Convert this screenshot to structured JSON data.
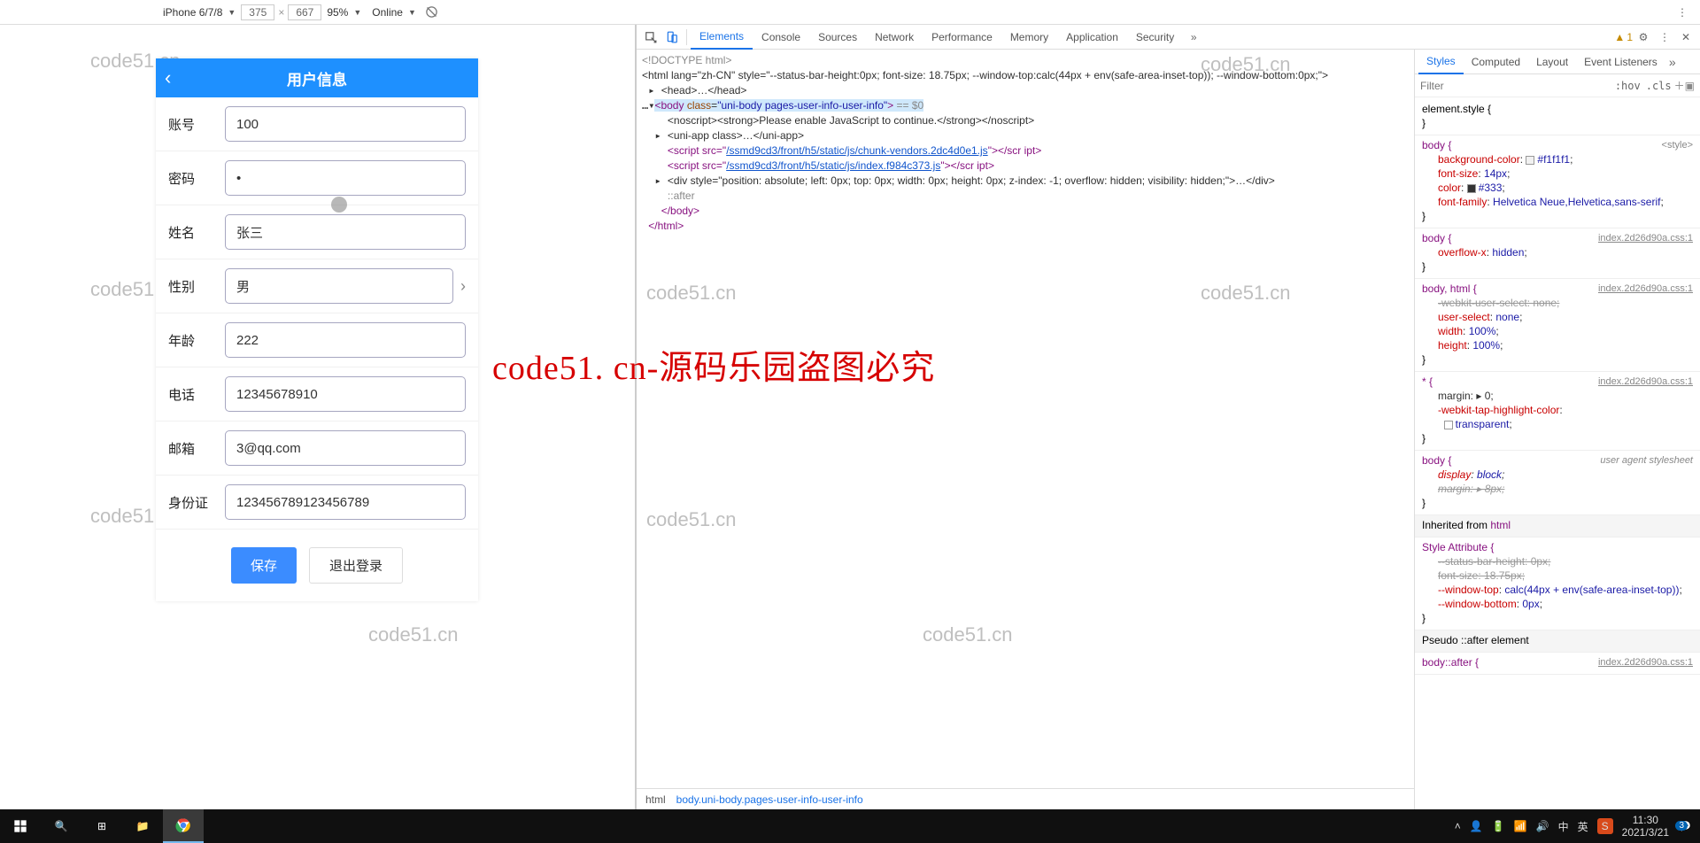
{
  "device_bar": {
    "device": "iPhone 6/7/8",
    "width": "375",
    "height": "667",
    "zoom": "95%",
    "throttle": "Online",
    "dim_sep": "×"
  },
  "devtools": {
    "tabs": [
      "Elements",
      "Console",
      "Sources",
      "Network",
      "Performance",
      "Memory",
      "Application",
      "Security"
    ],
    "active_tab": "Elements",
    "warning_count": "1",
    "styles_tabs": [
      "Styles",
      "Computed",
      "Layout",
      "Event Listeners"
    ],
    "styles_active": "Styles",
    "filter_placeholder": "Filter",
    "hov": ":hov",
    "cls": ".cls",
    "crumbs": [
      "html",
      "body.uni-body.pages-user-info-user-info"
    ],
    "dom": {
      "doctype": "<!DOCTYPE html>",
      "html_open": "<html lang=\"zh-CN\" style=\"--status-bar-height:0px; font-size: 18.75px; --window-top:calc(44px + env(safe-area-inset-top)); --window-bottom:0px;\">",
      "head": "<head>…</head>",
      "body_open": "<body class=\"uni-body pages-user-info-user-info\"> == $0",
      "noscript": "<noscript><strong>Please enable JavaScript to continue.</strong></noscript>",
      "uniapp": "<uni-app class>…</uni-app>",
      "script1_pre": "<script src=\"",
      "script1_link": "/ssmd9cd3/front/h5/static/js/chunk-vendors.2dc4d0e1.js",
      "script1_post": "\"></scr ipt>",
      "script2_pre": "<script src=\"",
      "script2_link": "/ssmd9cd3/front/h5/static/js/index.f984c373.js",
      "script2_post": "\"></scr ipt>",
      "div_hidden": "<div style=\"position: absolute; left: 0px; top: 0px; width: 0px; height: 0px; z-index: -1; overflow: hidden; visibility: hidden;\">…</div>",
      "after": "::after",
      "body_close": "</body>",
      "html_close": "</html>"
    },
    "rules": {
      "elstyle": "element.style {",
      "b1_sel": "body {",
      "b1_src": "<style>",
      "b1_p1_n": "background-color",
      "b1_p1_v": "#f1f1f1",
      "b1_p1_sw": "#f1f1f1",
      "b1_p2_n": "font-size",
      "b1_p2_v": "14px",
      "b1_p3_n": "color",
      "b1_p3_v": "#333",
      "b1_p3_sw": "#333333",
      "b1_p4_n": "font-family",
      "b1_p4_v": "Helvetica Neue,Helvetica,sans-serif",
      "b2_sel": "body {",
      "b2_link": "index.2d26d90a.css:1",
      "b2_p1_n": "overflow-x",
      "b2_p1_v": "hidden",
      "b3_sel": "body, html {",
      "b3_link": "index.2d26d90a.css:1",
      "b3_p1": "-webkit-user-select: none;",
      "b3_p2_n": "user-select",
      "b3_p2_v": "none",
      "b3_p3_n": "width",
      "b3_p3_v": "100%",
      "b3_p4_n": "height",
      "b3_p4_v": "100%",
      "b4_sel": "* {",
      "b4_link": "index.2d26d90a.css:1",
      "b4_p1": "margin: ▸ 0;",
      "b4_p2_n": "-webkit-tap-highlight-color",
      "b4_p2_v": "transparent",
      "b4_p2_sw": "transparent",
      "b5_sel": "body {",
      "b5_src": "user agent stylesheet",
      "b5_p1_n": "display",
      "b5_p1_v": "block",
      "b5_p2": "margin: ▸ 8px;",
      "inh": "Inherited from ",
      "inh_el": "html",
      "b6_sel": "Style Attribute {",
      "b6_p1": "--status-bar-height: 0px;",
      "b6_p2": "font-size: 18.75px;",
      "b6_p3_n": "--window-top",
      "b6_p3_v": "calc(44px + env(safe-area-inset-top))",
      "b6_p4_n": "--window-bottom",
      "b6_p4_v": "0px",
      "pseudo": "Pseudo ::after element",
      "b7_sel": "body::after {",
      "b7_link": "index.2d26d90a.css:1",
      "close": "}"
    }
  },
  "app": {
    "title": "用户信息",
    "rows": {
      "account_label": "账号",
      "account_value": "100",
      "password_label": "密码",
      "password_value": "•",
      "name_label": "姓名",
      "name_value": "张三",
      "gender_label": "性别",
      "gender_value": "男",
      "age_label": "年龄",
      "age_value": "222",
      "phone_label": "电话",
      "phone_value": "12345678910",
      "email_label": "邮箱",
      "email_value": "3@qq.com",
      "idcard_label": "身份证",
      "idcard_value": "123456789123456789"
    },
    "save_label": "保存",
    "logout_label": "退出登录"
  },
  "overlay": {
    "big_red": "code51. cn-源码乐园盗图必究"
  },
  "watermarks": {
    "w": "code51.cn"
  },
  "taskbar": {
    "time": "11:30",
    "date": "2021/3/21",
    "ime1": "中",
    "ime2": "英",
    "ime_badge": "S"
  }
}
